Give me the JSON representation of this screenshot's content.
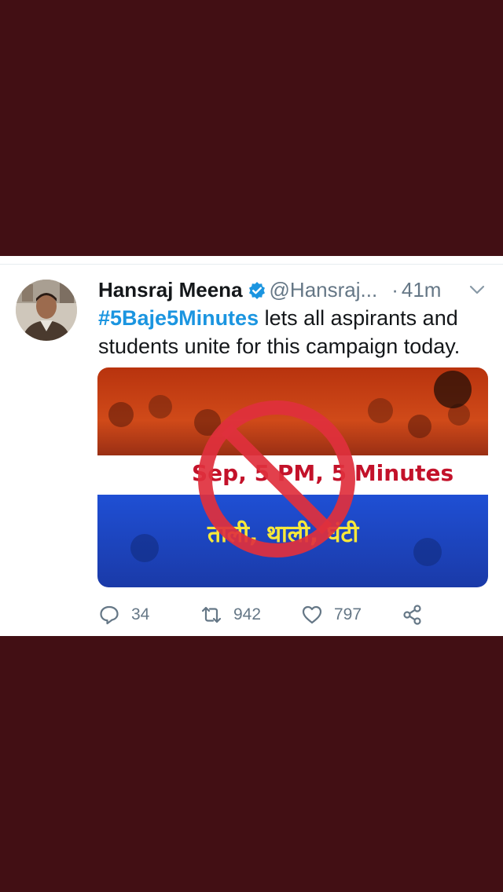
{
  "tweet": {
    "author_name": "Hansraj Meena",
    "handle": "@Hansraj...",
    "separator": "·",
    "time": "41m",
    "hashtag": "#5Baje5Minutes",
    "text": " lets all aspirants and students unite for this campaign today.",
    "media": {
      "line1": "Sep, 5 PM, 5 Minutes",
      "line2": "ताली, थाली, घंटी"
    },
    "actions": {
      "replies": "34",
      "retweets": "942",
      "likes": "797"
    }
  },
  "colors": {
    "background": "#420f14",
    "card": "#ffffff",
    "accent": "#1b95e0",
    "prohibition": "#e0303d"
  },
  "icons": [
    "verified-badge-icon",
    "chevron-down-icon",
    "reply-icon",
    "retweet-icon",
    "like-icon",
    "share-icon",
    "prohibition-sign-icon"
  ]
}
